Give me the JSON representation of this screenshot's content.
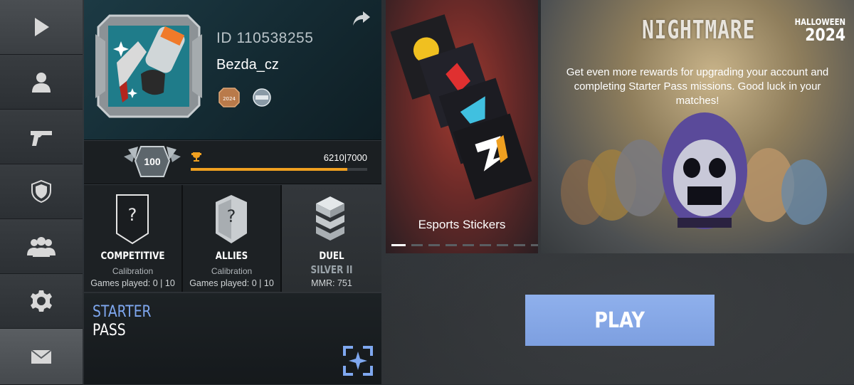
{
  "profile": {
    "id_text": "ID 110538255",
    "username": "Bezda_cz",
    "badge_year": "2024"
  },
  "level": {
    "value": "100",
    "xp_text": "6210|7000",
    "xp_current": 6210,
    "xp_max": 7000
  },
  "modes": [
    {
      "name": "COMPETITIVE",
      "status": "Calibration",
      "games": "Games played: 0 | 10"
    },
    {
      "name": "ALLIES",
      "status": "Calibration",
      "games": "Games played: 0 | 10"
    },
    {
      "name": "DUEL",
      "rank": "SILVER II",
      "mmr": "MMR: 751"
    }
  ],
  "starter_pass": {
    "line1": "STARTER",
    "line2": "PASS"
  },
  "promo": {
    "stickers_label": "Esports Stickers",
    "slide_count": 9,
    "active_slide": 0
  },
  "banner": {
    "title": "NIGHTMARE",
    "event_line1": "HALLOWEEN",
    "event_line2": "2024",
    "description": "Get even more rewards for upgrading your account and completing Starter Pass missions. Good luck in your matches!"
  },
  "play_button": {
    "label": "PLAY"
  },
  "sidebar": {
    "items": [
      "play-icon",
      "profile-icon",
      "pistol-icon",
      "shield-icon",
      "friends-icon",
      "gear-icon",
      "mail-icon"
    ]
  },
  "colors": {
    "accent": "#7fa8f0",
    "xp": "#f0a020",
    "play": "#8aabea"
  }
}
